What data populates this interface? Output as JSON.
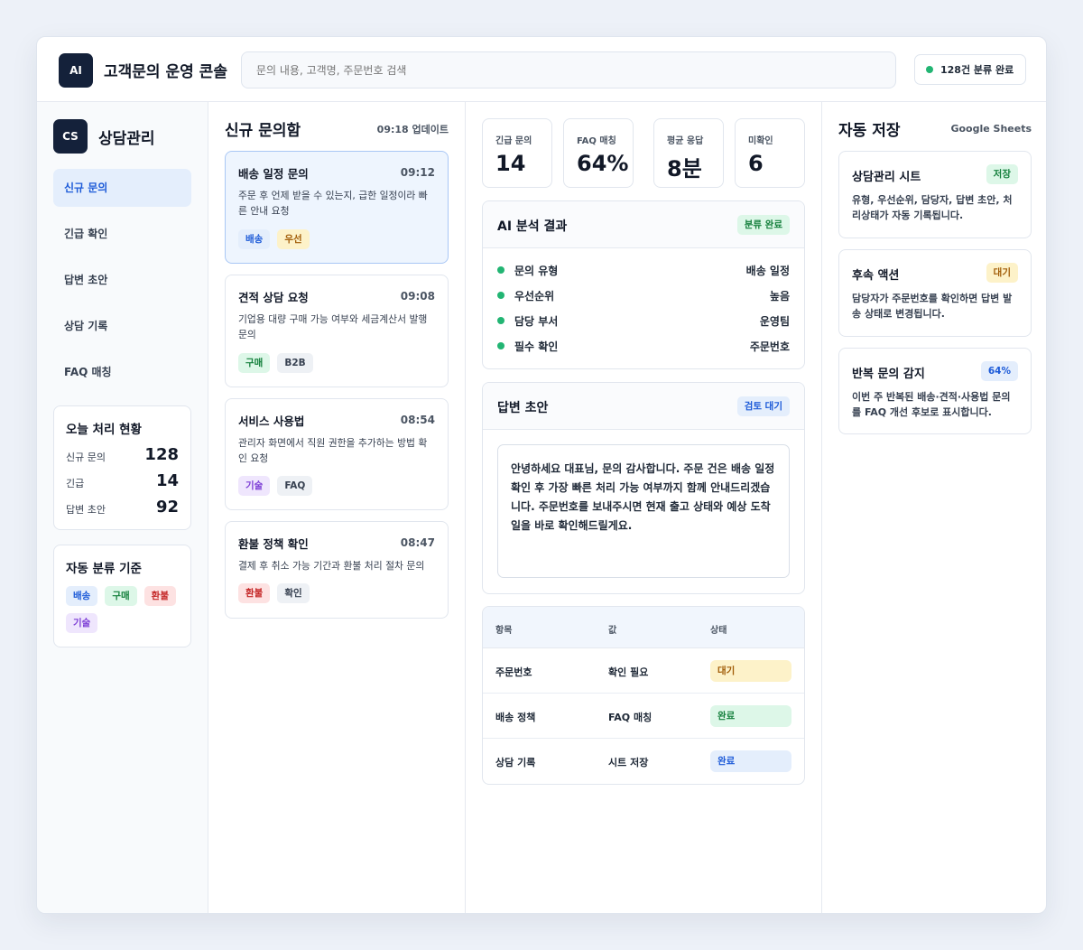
{
  "header": {
    "logo": "AI",
    "title": "고객문의 운영 콘솔",
    "search_placeholder": "문의 내용, 고객명, 주문번호 검색",
    "status": "128건 분류 완료",
    "status_color": "#22b573"
  },
  "sidebar": {
    "logo": "CS",
    "title": "상담관리",
    "items": [
      {
        "label": "신규 문의",
        "active": true
      },
      {
        "label": "긴급 확인"
      },
      {
        "label": "답변 초안"
      },
      {
        "label": "상담 기록"
      },
      {
        "label": "FAQ 매칭"
      }
    ],
    "today": {
      "title": "오늘 처리 현황",
      "rows": [
        {
          "label": "신규 문의",
          "value": "128"
        },
        {
          "label": "긴급",
          "value": "14"
        },
        {
          "label": "답변 초안",
          "value": "92"
        }
      ]
    },
    "criteria": {
      "title": "자동 분류 기준",
      "tags": [
        "배송",
        "구매",
        "환불",
        "기술"
      ]
    }
  },
  "inbox": {
    "title": "신규 문의함",
    "updated": "09:18 업데이트",
    "cards": [
      {
        "title": "배송 일정 문의",
        "time": "09:12",
        "body": "주문 후 언제 받을 수 있는지, 급한 일정이라 빠른 안내 요청",
        "tags": [
          "배송",
          "우선"
        ]
      },
      {
        "title": "견적 상담 요청",
        "time": "09:08",
        "body": "기업용 대량 구매 가능 여부와 세금계산서 발행 문의",
        "tags": [
          "구매",
          "B2B"
        ]
      },
      {
        "title": "서비스 사용법",
        "time": "08:54",
        "body": "관리자 화면에서 직원 권한을 추가하는 방법 확인 요청",
        "tags": [
          "기술",
          "FAQ"
        ]
      },
      {
        "title": "환불 정책 확인",
        "time": "08:47",
        "body": "결제 후 취소 가능 기간과 환불 처리 절차 문의",
        "tags": [
          "환불",
          "확인"
        ]
      }
    ]
  },
  "kpis": [
    {
      "label": "긴급 문의",
      "value": "14"
    },
    {
      "label": "FAQ 매칭",
      "value": "64%"
    },
    {
      "label": "평균 응답",
      "value": "8분"
    },
    {
      "label": "미확인",
      "value": "6"
    }
  ],
  "analysis": {
    "title": "AI 분석 결과",
    "badge": "분류 완료",
    "rows": [
      {
        "key": "문의 유형",
        "value": "배송 일정"
      },
      {
        "key": "우선순위",
        "value": "높음"
      },
      {
        "key": "담당 부서",
        "value": "운영팀"
      },
      {
        "key": "필수 확인",
        "value": "주문번호"
      }
    ]
  },
  "draft": {
    "title": "답변 초안",
    "badge": "검토 대기",
    "text": "안녕하세요 대표님, 문의 감사합니다. 주문 건은 배송 일정 확인 후 가장 빠른 처리 가능 여부까지 함께 안내드리겠습니다. 주문번호를 보내주시면 현재 출고 상태와 예상 도착일을 바로 확인해드릴게요."
  },
  "table": {
    "headers": [
      "항목",
      "값",
      "상태"
    ],
    "rows": [
      {
        "item": "주문번호",
        "value": "확인 필요",
        "state": "대기"
      },
      {
        "item": "배송 정책",
        "value": "FAQ 매칭",
        "state": "완료"
      },
      {
        "item": "상담 기록",
        "value": "시트 저장",
        "state": "완료"
      }
    ]
  },
  "autosave": {
    "title": "자동 저장",
    "target": "Google Sheets",
    "cards": [
      {
        "title": "상담관리 시트",
        "badge": "저장",
        "body": "유형, 우선순위, 담당자, 답변 초안, 처리상태가 자동 기록됩니다."
      },
      {
        "title": "후속 액션",
        "badge": "대기",
        "body": "담당자가 주문번호를 확인하면 답변 발송 상태로 변경됩니다."
      },
      {
        "title": "반복 문의 감지",
        "badge": "64%",
        "body": "이번 주 반복된 배송·견적·사용법 문의를 FAQ 개선 후보로 표시합니다."
      }
    ]
  }
}
